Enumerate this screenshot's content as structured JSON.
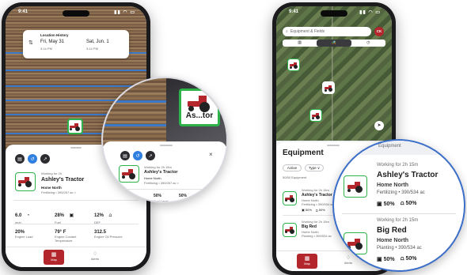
{
  "left_phone": {
    "status_time": "9:41",
    "location_history": {
      "title": "Location History",
      "from_date": "Fri, May 31",
      "from_time": "3:14 PM",
      "to_date": "Sat, Jun. 1",
      "to_time": "3:14 PM"
    },
    "detail": {
      "working": "Working for 2h",
      "name": "Ashley's Tractor",
      "location": "Home North",
      "task": "Fertilizing • 390/267 ac >"
    },
    "metrics_row1": [
      {
        "value": "6.0",
        "unit": "mph",
        "icon": "speed-icon"
      },
      {
        "value": "28%",
        "unit": "Fuel",
        "icon": "fuel-icon"
      },
      {
        "value": "12%",
        "unit": "DEF",
        "icon": "def-icon"
      }
    ],
    "metrics_row2": [
      {
        "value": "20%",
        "label": "Engine Load"
      },
      {
        "value": "79° F",
        "label": "Engine Coolant Temperature"
      },
      {
        "value": "312.5",
        "label": "Engine Oil Pressure"
      }
    ],
    "tabs": {
      "map": "Map",
      "alerts": "Alerts"
    }
  },
  "left_magnify": {
    "badge_label": "As...tor",
    "working": "Working for 2h 15m",
    "name": "Ashley's Tractor",
    "location": "Home North",
    "task": "Fertilizing • 390/267 ac >",
    "metric1": "50%",
    "metric1_label": "Fuel Level",
    "metric2": "50%",
    "metric2_label": "DEF",
    "close": "×"
  },
  "right_phone": {
    "status_time": "9:41",
    "search_placeholder": "Equipment & Fields",
    "avatar": "CK",
    "sheet_title": "Equipment",
    "filters": [
      "Active",
      "Type ∨"
    ],
    "count": "50/50 Equipment",
    "list": [
      {
        "working": "Working for 2h 15m",
        "name": "Ashley's Tractor",
        "location": "Home North",
        "task": "Fertilizing • 390/534 ac",
        "fuel": "50%",
        "def": "50%"
      },
      {
        "working": "Working for 2h 15m",
        "name": "Big Red",
        "location": "Home North",
        "task": "Planting • 390/534 ac",
        "fuel": "50%",
        "def": "50%"
      }
    ],
    "tabs": {
      "map": "Map",
      "alerts": "Alerts"
    }
  },
  "right_magnify": {
    "header": "Equipment",
    "list": [
      {
        "working": "Working for 2h 15m",
        "name": "Ashley's Tractor",
        "location": "Home North",
        "task": "Fertilizing • 390/534 ac",
        "fuel": "50%",
        "def": "50%"
      },
      {
        "working": "Working for 2h 15m",
        "name": "Big Red",
        "location": "Home North",
        "task": "Planting • 390/534 ac",
        "fuel": "50%",
        "def": "50%"
      }
    ]
  },
  "colors": {
    "brand_red": "#b3262b",
    "status_green": "#2db34a",
    "accent_blue": "#2f7fe0"
  }
}
